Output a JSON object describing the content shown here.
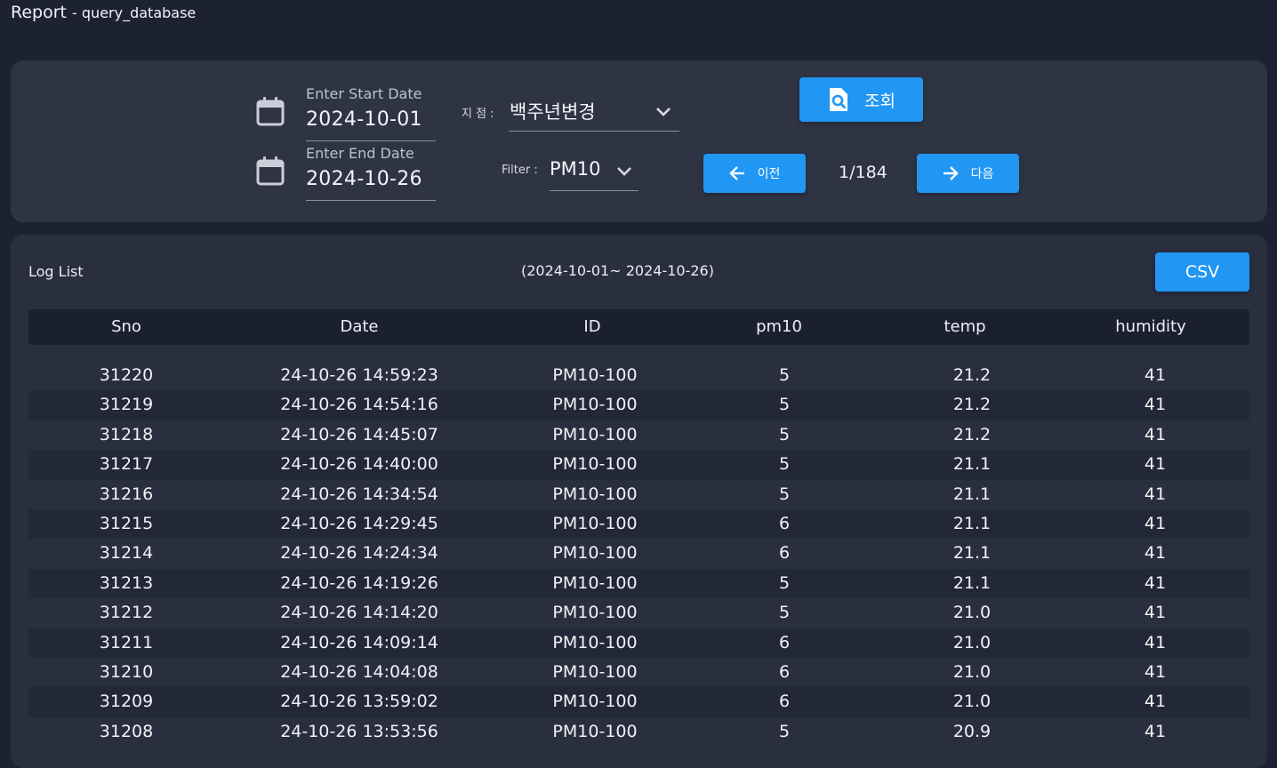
{
  "window": {
    "title": "Report",
    "subtitle": "- query_database"
  },
  "filters": {
    "start_date": {
      "label": "Enter Start Date",
      "value": "2024-10-01"
    },
    "end_date": {
      "label": "Enter End Date",
      "value": "2024-10-26"
    },
    "branch": {
      "label": "지 점 :",
      "value": "백주년변경"
    },
    "filter": {
      "label": "Filter :",
      "value": "PM10"
    },
    "search_button": "조회",
    "prev_button": "이전",
    "next_button": "다음",
    "page_indicator": "1/184"
  },
  "log": {
    "title": "Log List",
    "range": "(2024-10-01~ 2024-10-26)",
    "csv_button": "CSV",
    "columns": [
      "Sno",
      "Date",
      "ID",
      "pm10",
      "temp",
      "humidity"
    ],
    "rows": [
      [
        "31220",
        "24-10-26 14:59:23",
        "PM10-100",
        "5",
        "21.2",
        "41"
      ],
      [
        "31219",
        "24-10-26 14:54:16",
        "PM10-100",
        "5",
        "21.2",
        "41"
      ],
      [
        "31218",
        "24-10-26 14:45:07",
        "PM10-100",
        "5",
        "21.2",
        "41"
      ],
      [
        "31217",
        "24-10-26 14:40:00",
        "PM10-100",
        "5",
        "21.1",
        "41"
      ],
      [
        "31216",
        "24-10-26 14:34:54",
        "PM10-100",
        "5",
        "21.1",
        "41"
      ],
      [
        "31215",
        "24-10-26 14:29:45",
        "PM10-100",
        "6",
        "21.1",
        "41"
      ],
      [
        "31214",
        "24-10-26 14:24:34",
        "PM10-100",
        "6",
        "21.1",
        "41"
      ],
      [
        "31213",
        "24-10-26 14:19:26",
        "PM10-100",
        "5",
        "21.1",
        "41"
      ],
      [
        "31212",
        "24-10-26 14:14:20",
        "PM10-100",
        "5",
        "21.0",
        "41"
      ],
      [
        "31211",
        "24-10-26 14:09:14",
        "PM10-100",
        "6",
        "21.0",
        "41"
      ],
      [
        "31210",
        "24-10-26 14:04:08",
        "PM10-100",
        "6",
        "21.0",
        "41"
      ],
      [
        "31209",
        "24-10-26 13:59:02",
        "PM10-100",
        "6",
        "21.0",
        "41"
      ],
      [
        "31208",
        "24-10-26 13:53:56",
        "PM10-100",
        "5",
        "20.9",
        "41"
      ]
    ]
  },
  "colors": {
    "accent": "#2196f3",
    "background": "#1d2233",
    "panel": "#2f3444"
  },
  "icons": [
    "calendar-icon",
    "chevron-down-icon",
    "search-document-icon",
    "arrow-left-icon",
    "arrow-right-icon"
  ]
}
